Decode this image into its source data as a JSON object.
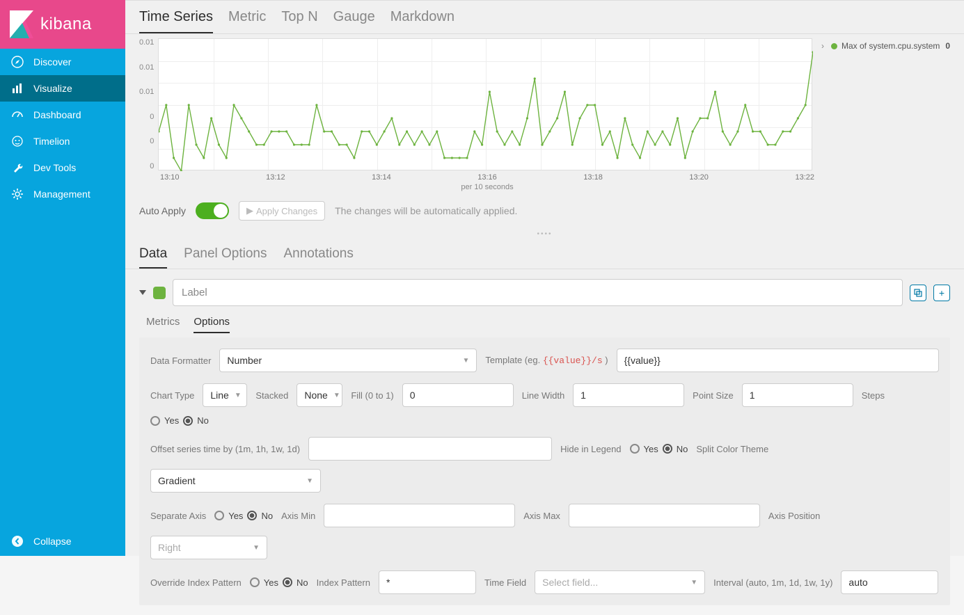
{
  "brand": {
    "name": "kibana"
  },
  "sidebar": {
    "items": [
      {
        "label": "Discover"
      },
      {
        "label": "Visualize"
      },
      {
        "label": "Dashboard"
      },
      {
        "label": "Timelion"
      },
      {
        "label": "Dev Tools"
      },
      {
        "label": "Management"
      }
    ],
    "collapse": "Collapse"
  },
  "vis_tabs": [
    "Time Series",
    "Metric",
    "Top N",
    "Gauge",
    "Markdown"
  ],
  "chart_data": {
    "type": "line",
    "title": "",
    "xlabel": "",
    "ylabel": "",
    "x_sub": "per 10 seconds",
    "y_ticks": [
      "0.01",
      "0.01",
      "0.01",
      "0",
      "0",
      "0"
    ],
    "ylim": [
      0,
      0.01
    ],
    "x_ticks": [
      "13:10",
      "13:12",
      "13:14",
      "13:16",
      "13:18",
      "13:20",
      "13:22"
    ],
    "series": [
      {
        "name": "Max of system.cpu.system",
        "color": "#6db33f",
        "legend_value": "0",
        "values": [
          0.003,
          0.005,
          0.001,
          0,
          0.005,
          0.002,
          0.001,
          0.004,
          0.002,
          0.001,
          0.005,
          0.004,
          0.003,
          0.002,
          0.002,
          0.003,
          0.003,
          0.003,
          0.002,
          0.002,
          0.002,
          0.005,
          0.003,
          0.003,
          0.002,
          0.002,
          0.001,
          0.003,
          0.003,
          0.002,
          0.003,
          0.004,
          0.002,
          0.003,
          0.002,
          0.003,
          0.002,
          0.003,
          0.001,
          0.001,
          0.001,
          0.001,
          0.003,
          0.002,
          0.006,
          0.003,
          0.002,
          0.003,
          0.002,
          0.004,
          0.007,
          0.002,
          0.003,
          0.004,
          0.006,
          0.002,
          0.004,
          0.005,
          0.005,
          0.002,
          0.003,
          0.001,
          0.004,
          0.002,
          0.001,
          0.003,
          0.002,
          0.003,
          0.002,
          0.004,
          0.001,
          0.003,
          0.004,
          0.004,
          0.006,
          0.003,
          0.002,
          0.003,
          0.005,
          0.003,
          0.003,
          0.002,
          0.002,
          0.003,
          0.003,
          0.004,
          0.005,
          0.009
        ]
      }
    ]
  },
  "apply": {
    "label": "Auto Apply",
    "button": "Apply Changes",
    "note": "The changes will be automatically applied."
  },
  "cfg_tabs": [
    "Data",
    "Panel Options",
    "Annotations"
  ],
  "series_header": {
    "placeholder": "Label",
    "color": "#6db33f"
  },
  "sub_tabs": [
    "Metrics",
    "Options"
  ],
  "options": {
    "data_formatter": {
      "label": "Data Formatter",
      "value": "Number"
    },
    "template": {
      "label": "Template (eg.",
      "hint": "{{value}}/s",
      "value": "{{value}}"
    },
    "chart_type": {
      "label": "Chart Type",
      "value": "Line"
    },
    "stacked": {
      "label": "Stacked",
      "value": "None"
    },
    "fill": {
      "label": "Fill (0 to 1)",
      "value": "0"
    },
    "line_width": {
      "label": "Line Width",
      "value": "1"
    },
    "point_size": {
      "label": "Point Size",
      "value": "1"
    },
    "steps": {
      "label": "Steps",
      "yes": "Yes",
      "no": "No",
      "value": "No"
    },
    "offset": {
      "label": "Offset series time by (1m, 1h, 1w, 1d)",
      "value": ""
    },
    "hide_legend": {
      "label": "Hide in Legend",
      "yes": "Yes",
      "no": "No",
      "value": "No"
    },
    "split_color": {
      "label": "Split Color Theme",
      "value": "Gradient"
    },
    "separate_axis": {
      "label": "Separate Axis",
      "yes": "Yes",
      "no": "No",
      "value": "No"
    },
    "axis_min": {
      "label": "Axis Min",
      "value": ""
    },
    "axis_max": {
      "label": "Axis Max",
      "value": ""
    },
    "axis_position": {
      "label": "Axis Position",
      "value": "Right"
    },
    "override_index": {
      "label": "Override Index Pattern",
      "yes": "Yes",
      "no": "No",
      "value": "No"
    },
    "index_pattern": {
      "label": "Index Pattern",
      "value": "*"
    },
    "time_field": {
      "label": "Time Field",
      "placeholder": "Select field..."
    },
    "interval": {
      "label": "Interval (auto, 1m, 1d, 1w, 1y)",
      "value": "auto"
    }
  }
}
